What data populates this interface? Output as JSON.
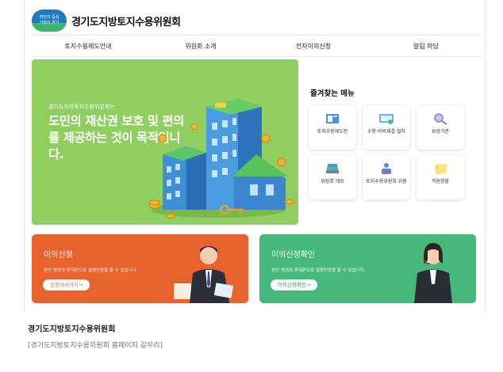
{
  "header": {
    "logo_line1": "편민의 중심",
    "logo_line2": "기회의 경기",
    "title": "경기도지방토지수용위원회"
  },
  "nav": {
    "items": [
      "토지수용제도안내",
      "위원회 소개",
      "전자이의신청",
      "알림 마당"
    ]
  },
  "hero": {
    "small_text": "경기도지방토지수용위원회는",
    "headline": "도민의 재산권 보호 및 편의를 제공하는 것이 목적입니다."
  },
  "favorites": {
    "title": "즐겨찾는 메뉴",
    "items": [
      {
        "label": "토지수용제도란",
        "icon": "book-icon"
      },
      {
        "label": "수용·이의재결 절차",
        "icon": "monitor-icon"
      },
      {
        "label": "보상기준",
        "icon": "magnifier-icon"
      },
      {
        "label": "위원회 개요",
        "icon": "books-icon"
      },
      {
        "label": "토지수용위원회 위원",
        "icon": "people-icon"
      },
      {
        "label": "직원현황",
        "icon": "notes-icon"
      }
    ]
  },
  "cards": {
    "objection": {
      "title": "이의신청",
      "desc": "본인 명의의 휴대폰으로 실명인증을 할 수 있습니다.",
      "button": "신청하러가기→",
      "color": "#e8622e"
    },
    "objection_check": {
      "title": "이의신청확인",
      "desc": "본인 명의의 휴대폰으로 실명인증을 할 수 있습니다.",
      "button": "이의신청확인→",
      "color": "#46b87c"
    }
  },
  "caption": {
    "title": "경기도지방토지수용위원회",
    "subtitle": "[경기도지방토지수용위원회 홈페이지 갈무리]"
  },
  "colors": {
    "hero_bg": "#8fcf60",
    "orange": "#e8622e",
    "green": "#46b87c",
    "logo_blue": "#1e7bbf"
  }
}
